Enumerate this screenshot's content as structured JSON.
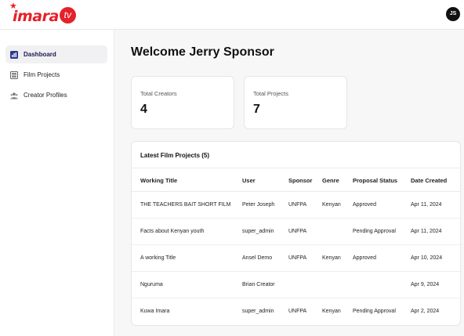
{
  "header": {
    "logo_text": "imara",
    "logo_badge": "tv",
    "avatar_initials": "JS"
  },
  "sidebar": {
    "items": [
      {
        "label": "Dashboard",
        "icon": "bar-chart-icon",
        "active": true
      },
      {
        "label": "Film Projects",
        "icon": "film-icon",
        "active": false
      },
      {
        "label": "Creator Profiles",
        "icon": "users-icon",
        "active": false
      }
    ]
  },
  "main": {
    "title": "Welcome Jerry Sponsor",
    "stats": [
      {
        "label": "Total Creators",
        "value": "4"
      },
      {
        "label": "Total Projects",
        "value": "7"
      }
    ],
    "table": {
      "title": "Latest Film Projects (5)",
      "columns": [
        "Working Title",
        "User",
        "Sponsor",
        "Genre",
        "Proposal Status",
        "Date Created"
      ],
      "rows": [
        [
          "THE TEACHERS BAIT SHORT FILM",
          "Peter Joseph",
          "UNFPA",
          "Kenyan",
          "Approved",
          "Apr 11, 2024"
        ],
        [
          "Facts about Kenyan youth",
          "super_admin",
          "UNFPA",
          "",
          "Pending Approval",
          "Apr 11, 2024"
        ],
        [
          "A working Title",
          "Ansel Demo",
          "UNFPA",
          "Kenyan",
          "Approved",
          "Apr 10, 2024"
        ],
        [
          "Nguruma",
          "Brian Creator",
          "",
          "",
          "",
          "Apr 9, 2024"
        ],
        [
          "Kuwa Imara",
          "super_admin",
          "UNFPA",
          "Kenyan",
          "Pending Approval",
          "Apr 2, 2024"
        ]
      ]
    }
  },
  "colors": {
    "brand": "#e62129",
    "active_nav_text": "#1a1a4e",
    "icon_blue": "#2b3a8f"
  }
}
